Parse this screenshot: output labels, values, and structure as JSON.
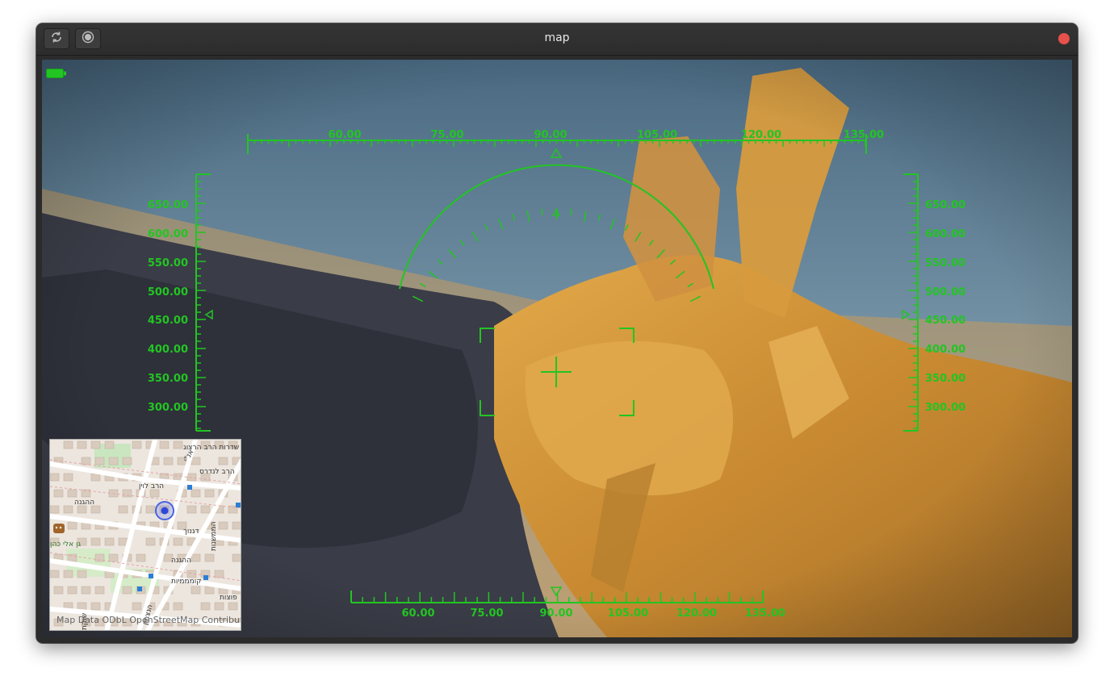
{
  "window": {
    "title": "map",
    "buttons": [
      {
        "icon": "refresh-icon"
      },
      {
        "icon": "record-icon"
      }
    ]
  },
  "hud": {
    "color": "#22c522",
    "top_scale": [
      "60.00",
      "75.00",
      "90.00",
      "105.00",
      "120.00",
      "135.00"
    ],
    "bottom_scale": [
      "60.00",
      "75.00",
      "90.00",
      "105.00",
      "120.00",
      "135.00"
    ],
    "left_scale": [
      "650.00",
      "600.00",
      "550.00",
      "500.00",
      "450.00",
      "400.00",
      "350.00",
      "300.00"
    ],
    "right_scale": [
      "650.00",
      "600.00",
      "550.00",
      "500.00",
      "450.00",
      "400.00",
      "350.00",
      "300.00"
    ]
  },
  "map": {
    "attribution": "Map Data ODbL OpenStreetMap Contributors",
    "streets": [
      "שדרות הרב הרצוג",
      "הרב לנדרס",
      "אנ\"י",
      "ההגנה",
      "דגנוך",
      "ההגנה",
      "הרב לוין",
      "קומממיות",
      "הממשנות",
      "גן אלי כהן",
      "הנצחון",
      "פוצות",
      "שוקת"
    ]
  }
}
